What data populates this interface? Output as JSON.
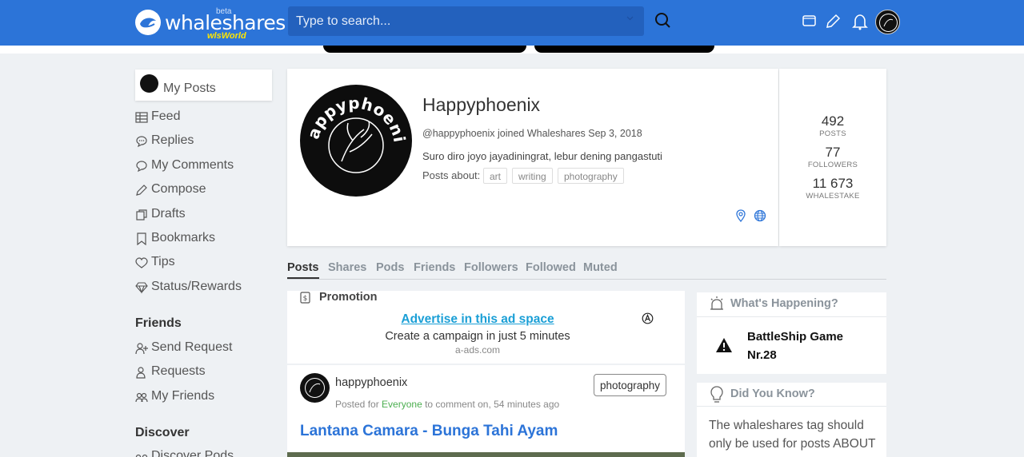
{
  "header": {
    "logo_text": "whaleshares",
    "logo_beta": "beta",
    "logo_world": "wlsWorld",
    "search_placeholder": "Type to search..."
  },
  "sidebar": {
    "my_posts": "My Posts",
    "items": [
      {
        "label": "Feed",
        "icon": "feed-icon"
      },
      {
        "label": "Replies",
        "icon": "replies-icon"
      },
      {
        "label": "My Comments",
        "icon": "comments-icon"
      },
      {
        "label": "Compose",
        "icon": "pencil-icon"
      },
      {
        "label": "Drafts",
        "icon": "drafts-icon"
      },
      {
        "label": "Bookmarks",
        "icon": "bookmark-icon"
      },
      {
        "label": "Tips",
        "icon": "tips-icon"
      },
      {
        "label": "Status/Rewards",
        "icon": "diamond-icon"
      }
    ],
    "friends_heading": "Friends",
    "friends_items": [
      {
        "label": "Send Request",
        "icon": "add-user-icon"
      },
      {
        "label": "Requests",
        "icon": "user-icon"
      },
      {
        "label": "My Friends",
        "icon": "users-icon"
      }
    ],
    "discover_heading": "Discover",
    "discover_items": [
      {
        "label": "Discover Pods",
        "icon": "pods-icon"
      }
    ]
  },
  "profile": {
    "name": "Happyphoenix",
    "avatar_text": "Happyphoenix",
    "meta": "@happyphoenix joined Whaleshares Sep 3, 2018",
    "bio": "Suro diro joyo jayadiningrat, lebur dening pangastuti",
    "posts_about_label": "Posts about:",
    "tags": [
      "art",
      "writing",
      "photography"
    ]
  },
  "stats": [
    {
      "value": "492",
      "label": "POSTS"
    },
    {
      "value": "77",
      "label": "FOLLOWERS"
    },
    {
      "value": "11 673",
      "label": "WHALESTAKE"
    }
  ],
  "tabs": [
    "Posts",
    "Shares",
    "Pods",
    "Friends",
    "Followers",
    "Followed",
    "Muted"
  ],
  "promo": {
    "title": "Promotion",
    "link": "Advertise in this ad space",
    "subtitle": "Create a campaign in just 5 minutes",
    "site": "a-ads.com"
  },
  "post": {
    "author": "happyphoenix",
    "meta_prefix": "Posted for",
    "meta_audience": "Everyone",
    "meta_suffix": "to comment on, 54 minutes ago",
    "tag": "photography",
    "title": "Lantana Camara - Bunga Tahi Ayam"
  },
  "whats_happening": {
    "heading": "What's Happening?",
    "item": "BattleShip Game Nr.28"
  },
  "did_you_know": {
    "heading": "Did You Know?",
    "text": "The whaleshares tag should only be used for posts ABOUT"
  },
  "colors": {
    "header_bg": "#2c74d8",
    "link": "#1a9fd6",
    "post_title": "#2c74d8"
  }
}
